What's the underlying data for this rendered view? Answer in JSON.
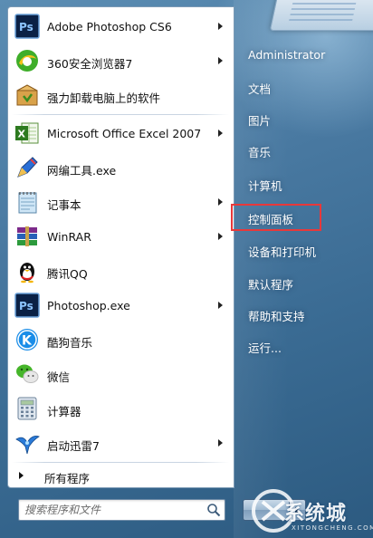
{
  "programs": [
    {
      "label": "Adobe Photoshop CS6",
      "icon": "photoshop-icon",
      "submenu": true
    },
    {
      "label": "360安全浏览器7",
      "icon": "360-browser-icon",
      "submenu": true
    },
    {
      "label": "强力卸载电脑上的软件",
      "icon": "uninstaller-icon",
      "submenu": false
    },
    {
      "label": "Microsoft Office Excel 2007",
      "icon": "excel-icon",
      "submenu": true
    },
    {
      "label": "网编工具.exe",
      "icon": "pen-tool-icon",
      "submenu": false
    },
    {
      "label": "记事本",
      "icon": "notepad-icon",
      "submenu": true
    },
    {
      "label": "WinRAR",
      "icon": "winrar-icon",
      "submenu": true
    },
    {
      "label": "腾讯QQ",
      "icon": "qq-penguin-icon",
      "submenu": false
    },
    {
      "label": "Photoshop.exe",
      "icon": "photoshop-icon",
      "submenu": true
    },
    {
      "label": "酷狗音乐",
      "icon": "kugou-icon",
      "submenu": false
    },
    {
      "label": "微信",
      "icon": "wechat-icon",
      "submenu": false
    },
    {
      "label": "计算器",
      "icon": "calculator-icon",
      "submenu": false
    },
    {
      "label": "启动迅雷7",
      "icon": "thunder-bird-icon",
      "submenu": true
    }
  ],
  "all_programs_label": "所有程序",
  "search": {
    "placeholder": "搜索程序和文件"
  },
  "right_items": [
    {
      "label": "Administrator"
    },
    {
      "label": "文档"
    },
    {
      "label": "图片"
    },
    {
      "label": "音乐"
    },
    {
      "label": "计算机"
    },
    {
      "label": "控制面板"
    },
    {
      "label": "设备和打印机"
    },
    {
      "label": "默认程序"
    },
    {
      "label": "帮助和支持"
    },
    {
      "label": "运行..."
    }
  ],
  "highlighted_item": "控制面板",
  "watermark": {
    "text": "系统城",
    "sub": "XITONGCHENG.COM"
  },
  "colors": {
    "highlight": "#e8383a",
    "panel": "#ffffff",
    "frame": "#3a6b93"
  }
}
